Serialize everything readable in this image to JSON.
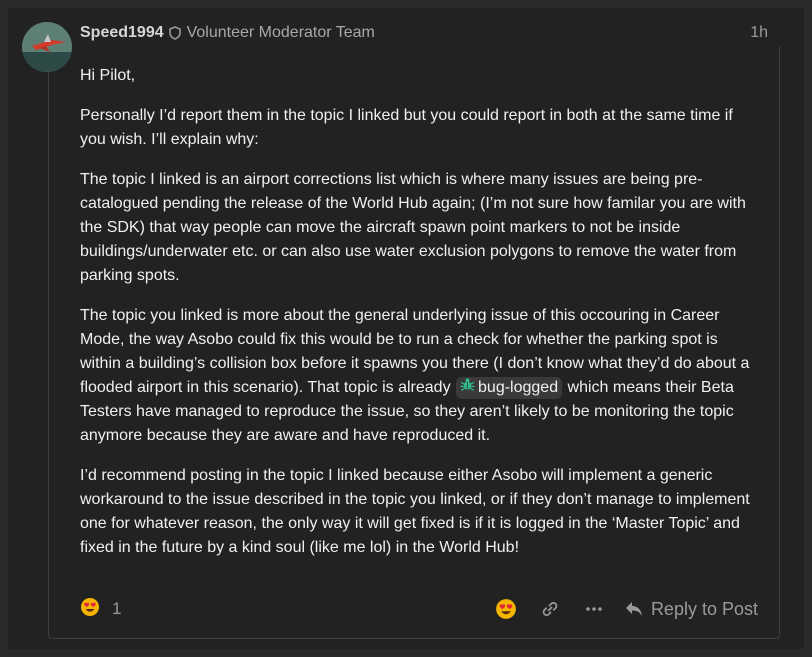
{
  "post": {
    "username": "Speed1994",
    "group": "Volunteer Moderator Team",
    "time": "1h",
    "paragraphs": [
      "Hi Pilot,",
      "Personally I’d report them in the topic I linked but you could report in both at the same time if you wish. I’ll explain why:",
      "The topic I linked is an airport corrections list which is where many issues are being pre-catalogued pending the release of the World Hub again; (I’m not sure how familar you are with the SDK) that way people can move the aircraft spawn point markers to not be inside buildings/underwater etc. or can also use water exclusion polygons to remove the water from parking spots."
    ],
    "p4_before": "The topic you linked is more about the general underlying issue of this occouring in Career Mode, the way Asobo could fix this would be to run a check for whether the parking spot is within a building’s collision box before it spawns you there (I don’t know what they’d do about a flooded airport in this scenario). That topic is already ",
    "tag": {
      "label": "bug-logged",
      "icon": "bug-icon"
    },
    "p4_after": " which means their Beta Testers have managed to reproduce the issue, so they aren’t likely to be monitoring the topic anymore because they are aware and have reproduced it.",
    "p5": "I’d recommend posting in the topic I linked because either Asobo will implement a generic workaround to the issue described in the topic you linked, or if they don’t manage to implement one for whatever reason, the only way it will get fixed is if it is logged in the ‘Master Topic’ and fixed in the future by a kind soul (like me lol) in the World Hub!"
  },
  "reactions": {
    "emoji": "heart-eyes-emoji",
    "count": "1"
  },
  "actions": {
    "react_icon": "heart-eyes-emoji",
    "link_icon": "link-icon",
    "more_icon": "more-icon",
    "reply_label": "Reply to Post"
  },
  "colors": {
    "background": "#222222",
    "border": "#3d3d3d",
    "muted": "#9a9a9a",
    "accent": "#f5b400"
  }
}
